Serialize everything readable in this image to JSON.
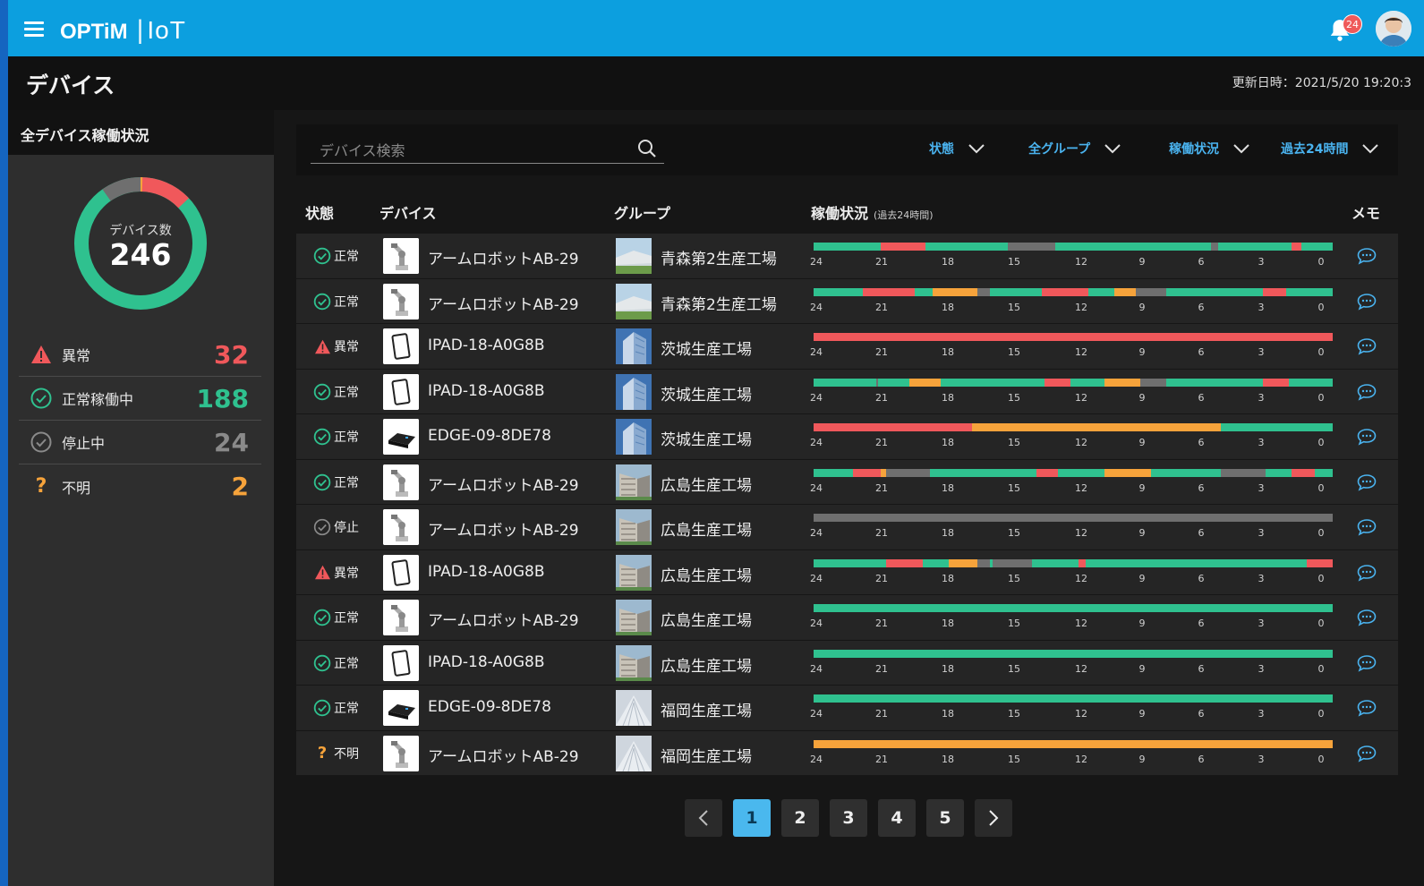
{
  "header": {
    "logo_brand": "OPTiM",
    "logo_product": "IoT",
    "notification_count": "24",
    "menu_icon": "hamburger-menu-icon",
    "bell_icon": "bell-icon",
    "colors": {
      "header_bg": "#0c9fdf",
      "accent": "#4ab3ef"
    }
  },
  "page": {
    "title": "デバイス",
    "updated": "更新日時：2021/5/20 19:20:3"
  },
  "sidebar": {
    "title": "全デバイス稼働状況",
    "donut_label": "デバイス数",
    "donut_total": "246",
    "stats": [
      {
        "label": "異常",
        "value": "32",
        "icon": "warning-icon",
        "color": "#f0585b"
      },
      {
        "label": "正常稼働中",
        "value": "188",
        "icon": "check-circle-icon",
        "color": "#2fc18f"
      },
      {
        "label": "停止中",
        "value": "24",
        "icon": "stop-circle-icon",
        "color": "#8a8a8a"
      },
      {
        "label": "不明",
        "value": "2",
        "icon": "question-icon",
        "color": "#f6a33b"
      }
    ]
  },
  "filters": {
    "search_placeholder": "デバイス検索",
    "status": "状態",
    "group": "全グループ",
    "operation": "稼働状況",
    "period": "過去24時間"
  },
  "table": {
    "headers": {
      "status": "状態",
      "device": "デバイス",
      "group": "グループ",
      "operation": "稼働状況",
      "operation_sub": "(過去24時間)",
      "memo": "メモ"
    },
    "ticks": [
      "24",
      "21",
      "18",
      "15",
      "12",
      "9",
      "6",
      "3",
      "0"
    ],
    "rows": [
      {
        "status": "正常",
        "device": "アームロボットAB-29",
        "device_type": "robot",
        "group": "青森第2生産工場",
        "group_type": "aomori",
        "timeline": [
          [
            "ok",
            13
          ],
          [
            "err",
            8.5
          ],
          [
            "ok",
            16
          ],
          [
            "stop",
            9
          ],
          [
            "ok",
            30
          ],
          [
            "stop",
            1.5
          ],
          [
            "ok",
            14
          ],
          [
            "err",
            2
          ],
          [
            "ok",
            6
          ]
        ]
      },
      {
        "status": "正常",
        "device": "アームロボットAB-29",
        "device_type": "robot",
        "group": "青森第2生産工場",
        "group_type": "aomori",
        "timeline": [
          [
            "ok",
            9.5
          ],
          [
            "err",
            10
          ],
          [
            "ok",
            3.5
          ],
          [
            "warn",
            8.5
          ],
          [
            "stop",
            2.5
          ],
          [
            "ok",
            10
          ],
          [
            "err",
            9
          ],
          [
            "ok",
            5
          ],
          [
            "warn",
            4
          ],
          [
            "stop",
            6
          ],
          [
            "ok",
            18.5
          ],
          [
            "err",
            4.5
          ],
          [
            "ok",
            9
          ]
        ]
      },
      {
        "status": "異常",
        "device": "IPAD-18-A0G8B",
        "device_type": "tablet",
        "group": "茨城生産工場",
        "group_type": "ibaraki",
        "timeline": [
          [
            "err",
            100
          ]
        ]
      },
      {
        "status": "正常",
        "device": "IPAD-18-A0G8B",
        "device_type": "tablet",
        "group": "茨城生産工場",
        "group_type": "ibaraki",
        "timeline": [
          [
            "ok",
            12
          ],
          [
            "stop",
            0.5
          ],
          [
            "ok",
            6
          ],
          [
            "warn",
            6
          ],
          [
            "ok",
            20
          ],
          [
            "err",
            5
          ],
          [
            "ok",
            6.5
          ],
          [
            "warn",
            7
          ],
          [
            "stop",
            5
          ],
          [
            "ok",
            18.5
          ],
          [
            "err",
            5
          ],
          [
            "ok",
            8.5
          ]
        ]
      },
      {
        "status": "正常",
        "device": "EDGE-09-8DE78",
        "device_type": "edge",
        "group": "茨城生産工場",
        "group_type": "ibaraki",
        "timeline": [
          [
            "err",
            30.5
          ],
          [
            "warn",
            48
          ],
          [
            "ok",
            21.5
          ]
        ]
      },
      {
        "status": "正常",
        "device": "アームロボットAB-29",
        "device_type": "robot",
        "group": "広島生産工場",
        "group_type": "hiroshima",
        "timeline": [
          [
            "ok",
            7.5
          ],
          [
            "err",
            5.5
          ],
          [
            "warn",
            1
          ],
          [
            "stop",
            8.5
          ],
          [
            "ok",
            20.5
          ],
          [
            "err",
            4
          ],
          [
            "ok",
            9
          ],
          [
            "warn",
            9
          ],
          [
            "ok",
            13.5
          ],
          [
            "stop",
            8.5
          ],
          [
            "ok",
            5
          ],
          [
            "err",
            4.5
          ],
          [
            "ok",
            3.5
          ]
        ]
      },
      {
        "status": "停止",
        "device": "アームロボットAB-29",
        "device_type": "robot",
        "group": "広島生産工場",
        "group_type": "hiroshima",
        "timeline": [
          [
            "stop",
            100
          ]
        ]
      },
      {
        "status": "異常",
        "device": "IPAD-18-A0G8B",
        "device_type": "tablet",
        "group": "広島生産工場",
        "group_type": "hiroshima",
        "timeline": [
          [
            "ok",
            14
          ],
          [
            "err",
            7
          ],
          [
            "ok",
            5
          ],
          [
            "warn",
            5.5
          ],
          [
            "stop",
            2.5
          ],
          [
            "ok",
            0.5
          ],
          [
            "stop",
            7.5
          ],
          [
            "ok",
            9
          ],
          [
            "err",
            1.5
          ],
          [
            "ok",
            42.5
          ],
          [
            "err",
            5
          ]
        ]
      },
      {
        "status": "正常",
        "device": "アームロボットAB-29",
        "device_type": "robot",
        "group": "広島生産工場",
        "group_type": "hiroshima",
        "timeline": [
          [
            "ok",
            100
          ]
        ]
      },
      {
        "status": "正常",
        "device": "IPAD-18-A0G8B",
        "device_type": "tablet",
        "group": "広島生産工場",
        "group_type": "hiroshima",
        "timeline": [
          [
            "ok",
            100
          ]
        ]
      },
      {
        "status": "正常",
        "device": "EDGE-09-8DE78",
        "device_type": "edge",
        "group": "福岡生産工場",
        "group_type": "fukuoka",
        "timeline": [
          [
            "ok",
            100
          ]
        ]
      },
      {
        "status": "不明",
        "device": "アームロボットAB-29",
        "device_type": "robot",
        "group": "福岡生産工場",
        "group_type": "fukuoka",
        "timeline": [
          [
            "warn",
            100
          ]
        ]
      }
    ],
    "colors": {
      "ok": "#2fc18f",
      "err": "#f0585b",
      "warn": "#f6a33b",
      "stop": "#6f6f6f"
    }
  },
  "pagination": {
    "pages": [
      "1",
      "2",
      "3",
      "4",
      "5"
    ],
    "current": "1"
  }
}
